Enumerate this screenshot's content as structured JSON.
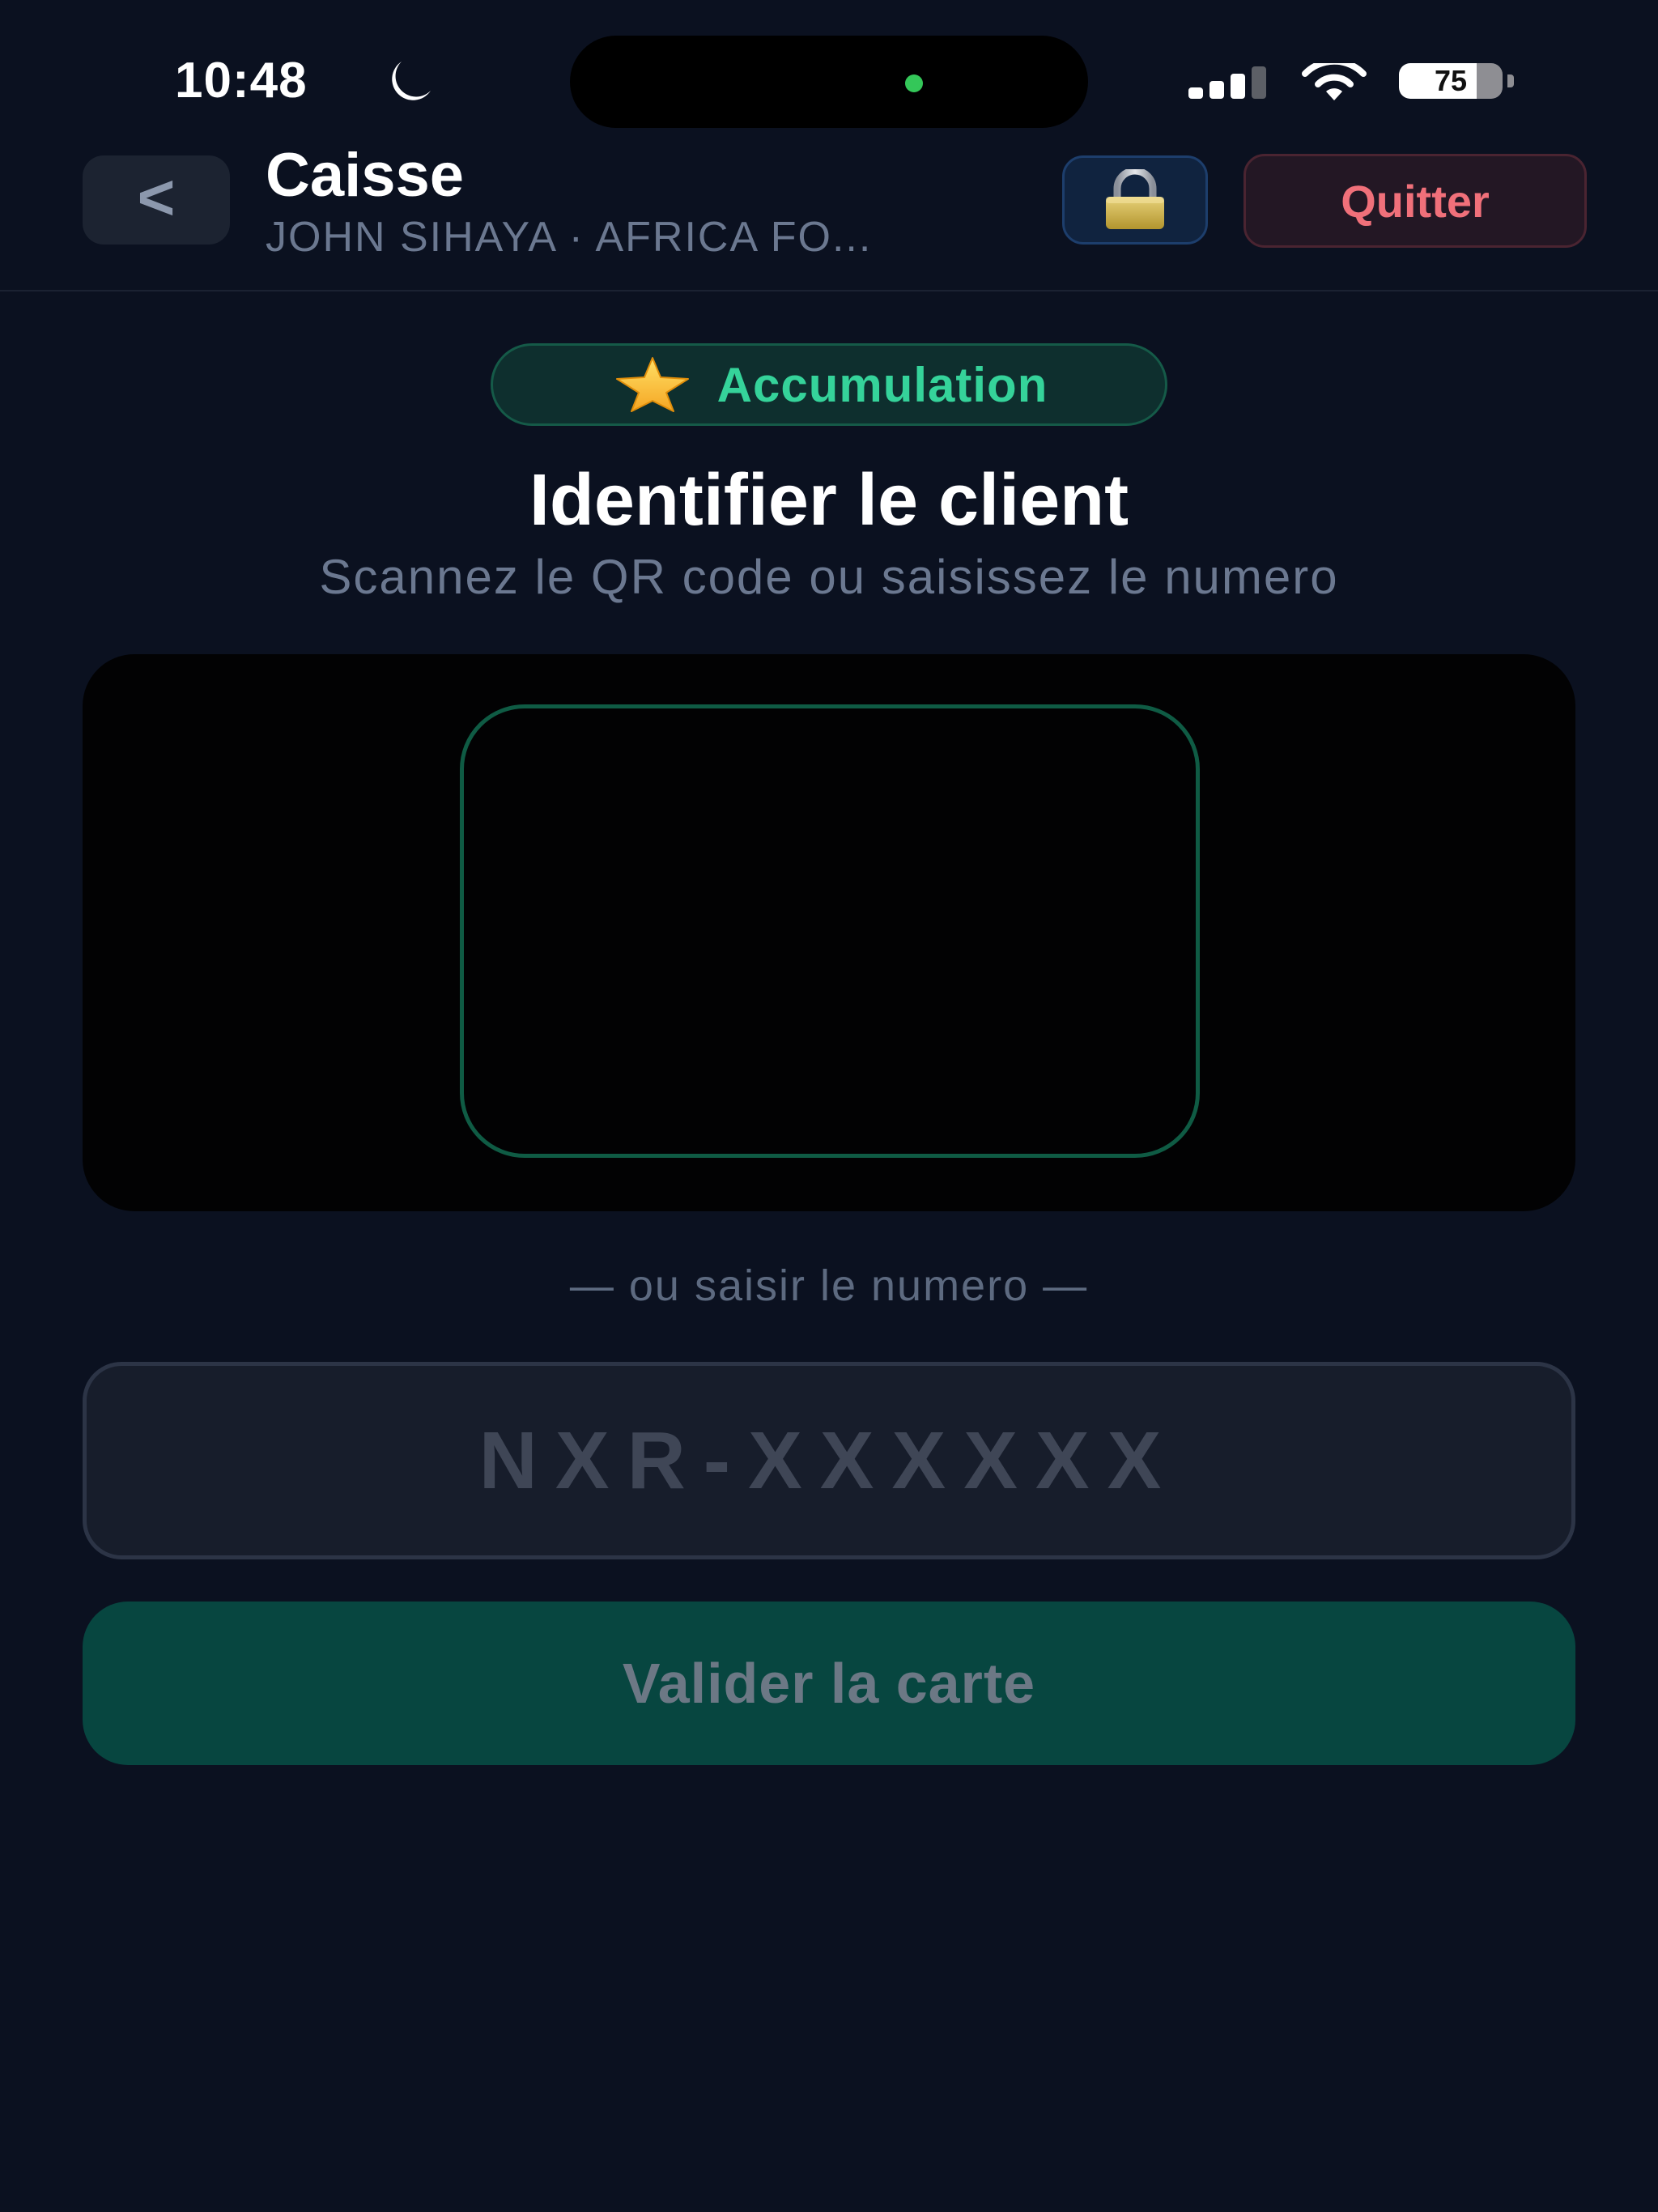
{
  "status_bar": {
    "time": "10:48",
    "battery_percent": "75",
    "battery_level": 0.75,
    "icons": [
      "moon-icon",
      "signal-icon",
      "wifi-icon",
      "battery-icon"
    ]
  },
  "header": {
    "back_label": "<",
    "title": "Caisse",
    "subtitle": "JOHN SIHAYA · AFRICA FO...",
    "lock_icon": "lock-icon",
    "quit_label": "Quitter"
  },
  "mode": {
    "icon": "star-icon",
    "label": "Accumulation"
  },
  "main": {
    "title": "Identifier le client",
    "subtitle": "Scannez le QR code ou saisissez le numero",
    "or_label": "— ou saisir le numero —",
    "card_input": {
      "value": "",
      "placeholder": "NXR-XXXXXX"
    },
    "validate_label": "Valider la carte"
  },
  "colors": {
    "background": "#0b1120",
    "accent_green": "#35d39a",
    "button_green": "#074640",
    "danger": "#f0707a",
    "muted_text": "#6b7890"
  }
}
